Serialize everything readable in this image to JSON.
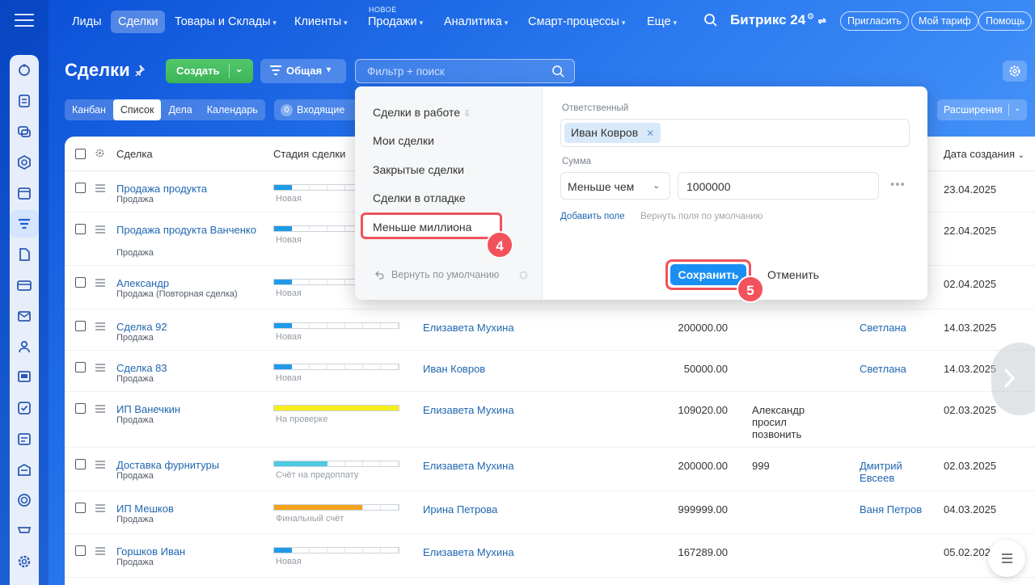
{
  "nav": {
    "items": [
      {
        "label": "Лиды",
        "caret": false
      },
      {
        "label": "Сделки",
        "caret": false
      },
      {
        "label": "Товары и Склады",
        "caret": true
      },
      {
        "label": "Клиенты",
        "caret": true
      },
      {
        "label": "Продажи",
        "caret": true
      },
      {
        "label": "Аналитика",
        "caret": true
      },
      {
        "label": "Смарт-процессы",
        "caret": true
      },
      {
        "label": "Еще",
        "caret": true
      }
    ],
    "new_badge": "НОВОЕ",
    "brand": "Битрикс 24",
    "invite": "Пригласить",
    "tariff": "Мой тариф",
    "help": "Помощь"
  },
  "toolbar": {
    "title": "Сделки",
    "create": "Создать",
    "filter_preset": "Общая",
    "search_placeholder": "Фильтр + поиск"
  },
  "views": {
    "tabs": [
      "Канбан",
      "Список",
      "Дела",
      "Календарь"
    ],
    "active": "Список",
    "incoming_count": "0",
    "incoming_label": "Входящие",
    "extensions": "Расширения"
  },
  "grid": {
    "headers": {
      "deal": "Сделка",
      "stage": "Стадия сделки",
      "created": "Дата создания"
    },
    "rows": [
      {
        "name": "Продажа продукта",
        "type": "Продажа",
        "stage": "Новая",
        "stage_color": "#1f9ae9",
        "stage_fill": 0.14,
        "resp": "",
        "sum": "",
        "comment": "",
        "contact": "",
        "date": "23.04.2025"
      },
      {
        "name": "Продажа продукта Ванченко",
        "type": "Продажа",
        "stage": "Новая",
        "stage_color": "#1f9ae9",
        "stage_fill": 0.14,
        "resp": "",
        "sum": "",
        "comment": "",
        "contact": "",
        "date": "22.04.2025"
      },
      {
        "name": "Александр",
        "type": "Продажа (Повторная сделка)",
        "stage": "Новая",
        "stage_color": "#1f9ae9",
        "stage_fill": 0.14,
        "resp": "",
        "sum": "",
        "comment": "",
        "contact": "",
        "date": "02.04.2025"
      },
      {
        "name": "Сделка 92",
        "type": "Продажа",
        "stage": "Новая",
        "stage_color": "#1f9ae9",
        "stage_fill": 0.14,
        "resp": "Елизавета Мухина",
        "sum": "200000.00",
        "comment": "",
        "contact": "Светлана",
        "date": "14.03.2025"
      },
      {
        "name": "Сделка 83",
        "type": "Продажа",
        "stage": "Новая",
        "stage_color": "#1f9ae9",
        "stage_fill": 0.14,
        "resp": "Иван Ковров",
        "sum": "50000.00",
        "comment": "",
        "contact": "Светлана",
        "date": "14.03.2025"
      },
      {
        "name": "ИП Ванечкин",
        "type": "Продажа",
        "stage": "На проверке",
        "stage_color": "#f5ee1b",
        "stage_fill": 1.0,
        "resp": "Елизавета Мухина",
        "sum": "109020.00",
        "comment": "Александр просил позвонить",
        "contact": "",
        "date": "02.03.2025"
      },
      {
        "name": "Доставка фурнитуры",
        "type": "Продажа",
        "stage": "Счёт на предоплату",
        "stage_color": "#4dc9e2",
        "stage_fill": 0.43,
        "resp": "Елизавета Мухина",
        "sum": "200000.00",
        "comment": "999",
        "contact": "Дмитрий Евсеев",
        "date": "02.03.2025"
      },
      {
        "name": "ИП Мешков",
        "type": "Продажа",
        "stage": "Финальный счёт",
        "stage_color": "#f5a31b",
        "stage_fill": 0.71,
        "resp": "Ирина Петрова",
        "sum": "999999.00",
        "comment": "",
        "contact": "Ваня Петров",
        "date": "04.03.2025"
      },
      {
        "name": "Горшков Иван",
        "type": "Продажа",
        "stage": "Новая",
        "stage_color": "#1f9ae9",
        "stage_fill": 0.14,
        "resp": "Елизавета Мухина",
        "sum": "167289.00",
        "comment": "",
        "contact": "",
        "date": "05.02.202"
      }
    ]
  },
  "popup": {
    "presets": [
      "Сделки в работе",
      "Мои сделки",
      "Закрытые сделки",
      "Сделки в отладке",
      "Меньше миллиона"
    ],
    "reset": "Вернуть по умолчанию",
    "responsible_label": "Ответственный",
    "responsible_value": "Иван Ковров",
    "sum_label": "Сумма",
    "sum_operator": "Меньше чем",
    "sum_value": "1000000",
    "add_field": "Добавить поле",
    "restore_fields": "Вернуть поля по умолчанию",
    "save": "Сохранить",
    "cancel": "Отменить",
    "step_preset": "4",
    "step_save": "5"
  },
  "colors": {
    "accent": "#1a8ff3",
    "highlight": "#f1525b",
    "link": "#2067b0",
    "create": "#3bb556"
  }
}
